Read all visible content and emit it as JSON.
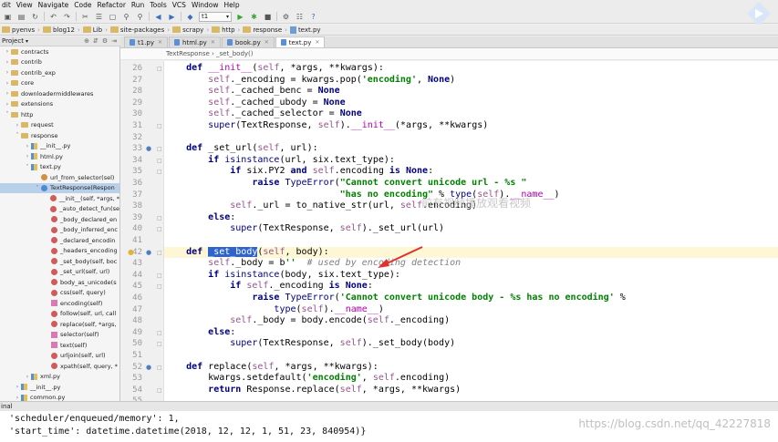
{
  "menu": [
    "dit",
    "View",
    "Navigate",
    "Code",
    "Refactor",
    "Run",
    "Tools",
    "VCS",
    "Window",
    "Help"
  ],
  "toolbar": {
    "run_config": "t1"
  },
  "breadcrumbs": [
    "pyenvs",
    "blog12",
    "Lib",
    "site-packages",
    "scrapy",
    "http",
    "response",
    "text.py"
  ],
  "project_panel": {
    "title": "Project"
  },
  "tabs": [
    {
      "label": "t1.py",
      "active": false
    },
    {
      "label": "html.py",
      "active": false
    },
    {
      "label": "book.py",
      "active": false
    },
    {
      "label": "text.py",
      "active": true
    }
  ],
  "editor_breadcrumb": "TextResponse  ›  _set_body()",
  "tree": [
    {
      "label": "contracts",
      "kind": "folder",
      "indent": 0,
      "arrow": "›"
    },
    {
      "label": "contrib",
      "kind": "folder",
      "indent": 0,
      "arrow": "›"
    },
    {
      "label": "contrib_exp",
      "kind": "folder",
      "indent": 0,
      "arrow": "›"
    },
    {
      "label": "core",
      "kind": "folder",
      "indent": 0,
      "arrow": "›"
    },
    {
      "label": "downloadermiddlewares",
      "kind": "folder",
      "indent": 0,
      "arrow": "›"
    },
    {
      "label": "extensions",
      "kind": "folder",
      "indent": 0,
      "arrow": "›"
    },
    {
      "label": "http",
      "kind": "folder",
      "indent": 0,
      "arrow": "˅"
    },
    {
      "label": "request",
      "kind": "folder",
      "indent": 1,
      "arrow": "›"
    },
    {
      "label": "response",
      "kind": "folder",
      "indent": 1,
      "arrow": "˅"
    },
    {
      "label": "__init__.py",
      "kind": "py",
      "indent": 2,
      "arrow": "›"
    },
    {
      "label": "html.py",
      "kind": "py",
      "indent": 2,
      "arrow": "›"
    },
    {
      "label": "text.py",
      "kind": "py",
      "indent": 2,
      "arrow": "˅"
    },
    {
      "label": "url_from_selector(sel)",
      "kind": "fld",
      "indent": 3,
      "arrow": ""
    },
    {
      "label": "TextResponse(Respon",
      "kind": "cls",
      "indent": 3,
      "arrow": "˅",
      "selected": true
    },
    {
      "label": "__init__(self, *args, *",
      "kind": "mth",
      "indent": 4,
      "arrow": ""
    },
    {
      "label": "_auto_detect_fun(se",
      "kind": "mth",
      "indent": 4,
      "arrow": ""
    },
    {
      "label": "_body_declared_en",
      "kind": "mth",
      "indent": 4,
      "arrow": ""
    },
    {
      "label": "_body_inferred_enc",
      "kind": "mth",
      "indent": 4,
      "arrow": ""
    },
    {
      "label": "_declared_encodin",
      "kind": "mth",
      "indent": 4,
      "arrow": ""
    },
    {
      "label": "_headers_encoding",
      "kind": "mth",
      "indent": 4,
      "arrow": ""
    },
    {
      "label": "_set_body(self, boc",
      "kind": "mth",
      "indent": 4,
      "arrow": ""
    },
    {
      "label": "_set_url(self, url)",
      "kind": "mth",
      "indent": 4,
      "arrow": ""
    },
    {
      "label": "body_as_unicode(s",
      "kind": "mth",
      "indent": 4,
      "arrow": ""
    },
    {
      "label": "css(self, query)",
      "kind": "mth",
      "indent": 4,
      "arrow": ""
    },
    {
      "label": "encoding(self)",
      "kind": "prop",
      "indent": 4,
      "arrow": ""
    },
    {
      "label": "follow(self, url, call",
      "kind": "mth",
      "indent": 4,
      "arrow": ""
    },
    {
      "label": "replace(self, *args,",
      "kind": "mth",
      "indent": 4,
      "arrow": ""
    },
    {
      "label": "selector(self)",
      "kind": "prop",
      "indent": 4,
      "arrow": ""
    },
    {
      "label": "text(self)",
      "kind": "prop",
      "indent": 4,
      "arrow": ""
    },
    {
      "label": "urljoin(self, url)",
      "kind": "mth",
      "indent": 4,
      "arrow": ""
    },
    {
      "label": "xpath(self, query, *",
      "kind": "mth",
      "indent": 4,
      "arrow": ""
    },
    {
      "label": "xml.py",
      "kind": "py",
      "indent": 2,
      "arrow": "›"
    },
    {
      "label": "__init__.py",
      "kind": "py",
      "indent": 1,
      "arrow": "›"
    },
    {
      "label": "common.py",
      "kind": "py",
      "indent": 1,
      "arrow": "›"
    }
  ],
  "code_lines": [
    {
      "n": 26,
      "html": "    <span class='kw'>def</span> <span class='dunder'>__init__</span>(<span class='self'>self</span>, *args, **kwargs):",
      "mark": "",
      "fold": "−"
    },
    {
      "n": 27,
      "html": "        <span class='self'>self</span>._encoding = kwargs.pop(<span class='str'>'encoding'</span>, <span class='kw'>None</span>)",
      "mark": "",
      "fold": ""
    },
    {
      "n": 28,
      "html": "        <span class='self'>self</span>._cached_benc = <span class='kw'>None</span>",
      "mark": "",
      "fold": ""
    },
    {
      "n": 29,
      "html": "        <span class='self'>self</span>._cached_ubody = <span class='kw'>None</span>",
      "mark": "",
      "fold": ""
    },
    {
      "n": 30,
      "html": "        <span class='self'>self</span>._cached_selector = <span class='kw'>None</span>",
      "mark": "",
      "fold": ""
    },
    {
      "n": 31,
      "html": "        <span class='builtin'>super</span>(TextResponse, <span class='self'>self</span>).<span class='dunder'>__init__</span>(*args, **kwargs)",
      "mark": "",
      "fold": "−"
    },
    {
      "n": 32,
      "html": "",
      "mark": "",
      "fold": ""
    },
    {
      "n": 33,
      "html": "    <span class='kw'>def</span> _set_url(<span class='self'>self</span>, url):",
      "mark": "o↑",
      "fold": "−"
    },
    {
      "n": 34,
      "html": "        <span class='kw'>if</span> <span class='builtin'>isinstance</span>(url, six.text_type):",
      "mark": "",
      "fold": "−"
    },
    {
      "n": 35,
      "html": "            <span class='kw'>if</span> six.PY2 <span class='kw'>and</span> <span class='self'>self</span>.encoding <span class='kw'>is</span> <span class='kw'>None</span>:",
      "mark": "",
      "fold": "−"
    },
    {
      "n": 36,
      "html": "                <span class='kw'>raise</span> <span class='builtin'>TypeError</span>(<span class='str'>\"Cannot convert unicode url - %s \"</span>",
      "mark": "",
      "fold": ""
    },
    {
      "n": 37,
      "html": "                                <span class='str'>\"has no encoding\"</span> % <span class='builtin'>type</span>(<span class='self'>self</span>).<span class='dunder'>__name__</span>)",
      "mark": "",
      "fold": ""
    },
    {
      "n": 38,
      "html": "            <span class='self'>self</span>._url = to_native_str(url, <span class='self'>self</span>.encoding)",
      "mark": "",
      "fold": ""
    },
    {
      "n": 39,
      "html": "        <span class='kw'>else</span>:",
      "mark": "",
      "fold": "−"
    },
    {
      "n": 40,
      "html": "            <span class='builtin'>super</span>(TextResponse, <span class='self'>self</span>)._set_url(url)",
      "mark": "",
      "fold": "−"
    },
    {
      "n": 41,
      "html": "",
      "mark": "",
      "fold": ""
    },
    {
      "n": 42,
      "html": "    <span class='kw'>def</span> <span class='sel-word'>_set_body</span>(<span class='self'>self</span>, body):",
      "mark": "o↑",
      "fold": "−",
      "bulb": true,
      "hl": true
    },
    {
      "n": 43,
      "html": "        <span class='self'>self</span>._body = b<span class='str'>''</span>  <span class='cmt'># used by encoding detection</span>",
      "mark": "",
      "fold": ""
    },
    {
      "n": 44,
      "html": "        <span class='kw'>if</span> <span class='builtin'>isinstance</span>(body, six.text_type):",
      "mark": "",
      "fold": "−"
    },
    {
      "n": 45,
      "html": "            <span class='kw'>if</span> <span class='self'>self</span>._encoding <span class='kw'>is</span> <span class='kw'>None</span>:",
      "mark": "",
      "fold": "−"
    },
    {
      "n": 46,
      "html": "                <span class='kw'>raise</span> <span class='builtin'>TypeError</span>(<span class='str'>'Cannot convert unicode body - %s has no encoding'</span> %",
      "mark": "",
      "fold": ""
    },
    {
      "n": 47,
      "html": "                    <span class='builtin'>type</span>(<span class='self'>self</span>).<span class='dunder'>__name__</span>)",
      "mark": "",
      "fold": ""
    },
    {
      "n": 48,
      "html": "            <span class='self'>self</span>._body = body.encode(<span class='self'>self</span>._encoding)",
      "mark": "",
      "fold": ""
    },
    {
      "n": 49,
      "html": "        <span class='kw'>else</span>:",
      "mark": "",
      "fold": "−"
    },
    {
      "n": 50,
      "html": "            <span class='builtin'>super</span>(TextResponse, <span class='self'>self</span>)._set_body(body)",
      "mark": "",
      "fold": "−"
    },
    {
      "n": 51,
      "html": "",
      "mark": "",
      "fold": ""
    },
    {
      "n": 52,
      "html": "    <span class='kw'>def</span> replace(<span class='self'>self</span>, *args, **kwargs):",
      "mark": "o↑",
      "fold": "−"
    },
    {
      "n": 53,
      "html": "        kwargs.setdefault(<span class='str'>'encoding'</span>, <span class='self'>self</span>.encoding)",
      "mark": "",
      "fold": ""
    },
    {
      "n": 54,
      "html": "        <span class='kw'>return</span> Response.replace(<span class='self'>self</span>, *args, **kwargs)",
      "mark": "",
      "fold": "−"
    },
    {
      "n": 55,
      "html": "",
      "mark": "",
      "fold": ""
    }
  ],
  "console": {
    "title": "inal",
    "lines": [
      "'scheduler/enqueued/memory': 1,",
      "'start_time': datetime.datetime(2018, 12, 12, 1, 51, 23, 840954)}"
    ]
  },
  "overlay_text": "前有视频播放观看视频",
  "watermark": "https://blog.csdn.net/qq_42227818",
  "colors": {
    "arrow": "#e0322b",
    "selection": "#2f65ca",
    "current_line": "#fdf7d6"
  }
}
